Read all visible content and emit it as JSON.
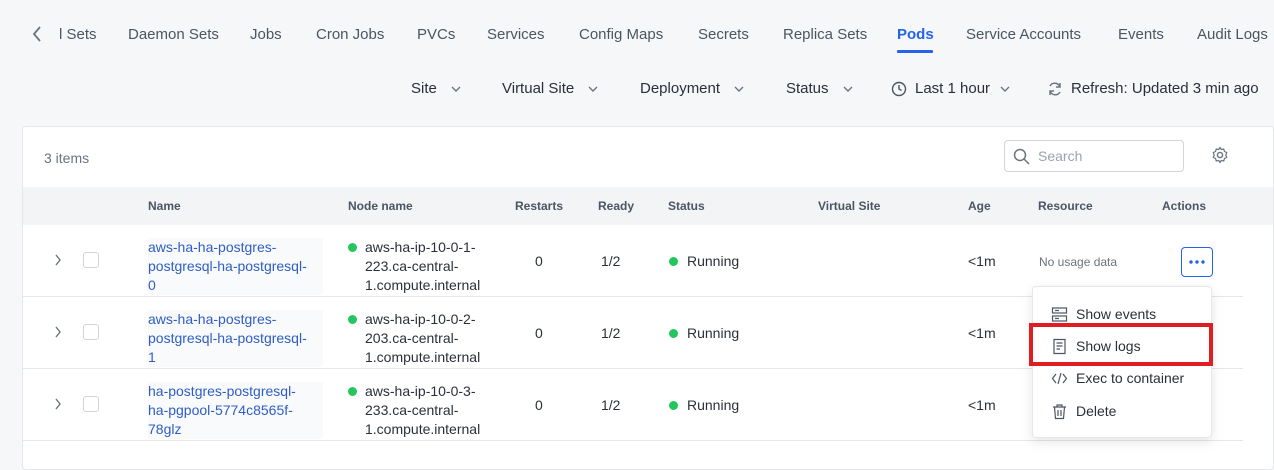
{
  "tabs": {
    "items": [
      "l Sets",
      "Daemon Sets",
      "Jobs",
      "Cron Jobs",
      "PVCs",
      "Services",
      "Config Maps",
      "Secrets",
      "Replica Sets",
      "Pods",
      "Service Accounts",
      "Events",
      "Audit Logs"
    ],
    "active": "Pods"
  },
  "filters": {
    "site": "Site",
    "virtual_site": "Virtual Site",
    "deployment": "Deployment",
    "status": "Status",
    "time_range": "Last 1 hour",
    "refresh": "Refresh: Updated 3 min ago"
  },
  "table": {
    "items_count": "3 items",
    "search_placeholder": "Search",
    "columns": [
      "Name",
      "Node name",
      "Restarts",
      "Ready",
      "Status",
      "Virtual Site",
      "Age",
      "Resource",
      "Actions"
    ],
    "rows": [
      {
        "name": [
          "aws-ha-ha-postgres-",
          "postgresql-ha-postgresql-",
          "0"
        ],
        "node": [
          "aws-ha-ip-10-0-1-",
          "223.ca-central-",
          "1.compute.internal"
        ],
        "restarts": "0",
        "ready": "1/2",
        "status": "Running",
        "virtual_site": "",
        "age": "<1m",
        "resource": "No usage data"
      },
      {
        "name": [
          "aws-ha-ha-postgres-",
          "postgresql-ha-postgresql-",
          "1"
        ],
        "node": [
          "aws-ha-ip-10-0-2-",
          "203.ca-central-",
          "1.compute.internal"
        ],
        "restarts": "0",
        "ready": "1/2",
        "status": "Running",
        "virtual_site": "",
        "age": "<1m",
        "resource": ""
      },
      {
        "name": [
          "ha-postgres-postgresql-",
          "ha-pgpool-5774c8565f-",
          "78glz"
        ],
        "node": [
          "aws-ha-ip-10-0-3-",
          "233.ca-central-",
          "1.compute.internal"
        ],
        "restarts": "0",
        "ready": "1/2",
        "status": "Running",
        "virtual_site": "",
        "age": "<1m",
        "resource": ""
      }
    ]
  },
  "actions_menu": {
    "show_events": "Show events",
    "show_logs": "Show logs",
    "exec": "Exec to container",
    "delete": "Delete"
  },
  "colors": {
    "accent": "#2563eb",
    "running": "#22c55e",
    "highlight": "#e11d24"
  }
}
